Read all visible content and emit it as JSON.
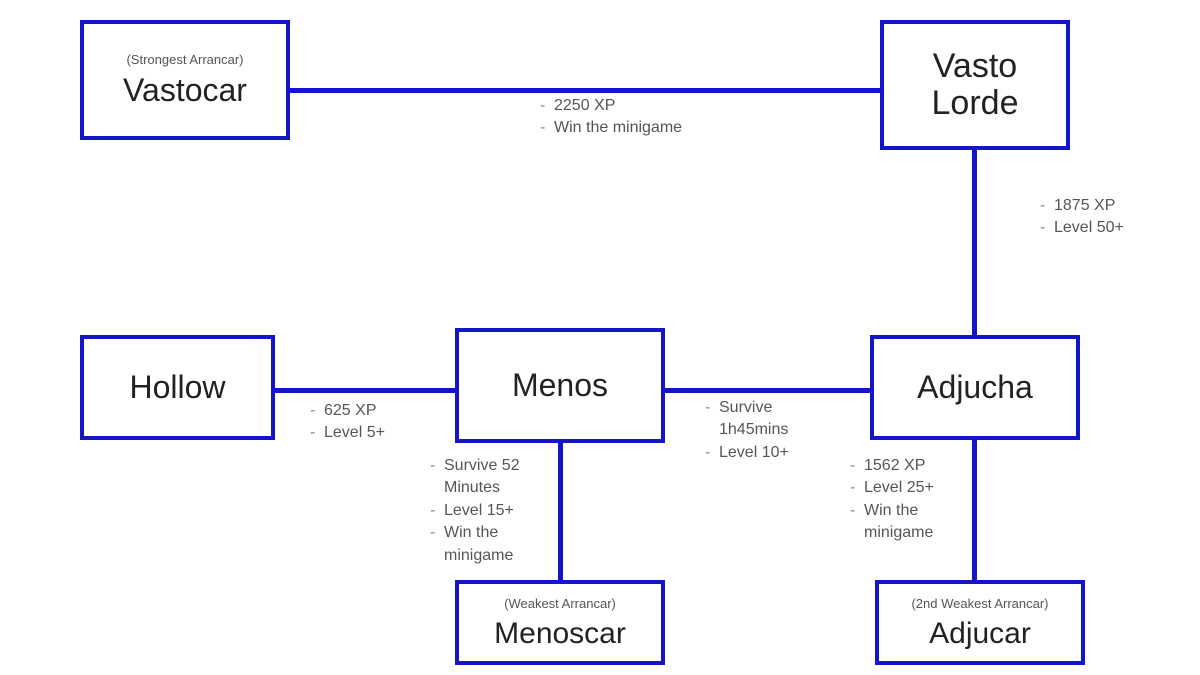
{
  "nodes": {
    "vastocar": {
      "title": "Vastocar",
      "subtitle": "(Strongest Arrancar)"
    },
    "vastolorde": {
      "title": "Vasto Lorde",
      "subtitle": ""
    },
    "hollow": {
      "title": "Hollow",
      "subtitle": ""
    },
    "menos": {
      "title": "Menos",
      "subtitle": ""
    },
    "adjucha": {
      "title": "Adjucha",
      "subtitle": ""
    },
    "menoscar": {
      "title": "Menoscar",
      "subtitle": "(Weakest Arrancar)"
    },
    "adjucar": {
      "title": "Adjucar",
      "subtitle": "(2nd Weakest Arrancar)"
    }
  },
  "edges": {
    "vastocar_vastolorde": {
      "r1": "2250 XP",
      "r2": "Win the minigame"
    },
    "vastolorde_adjucha": {
      "r1": "1875 XP",
      "r2": "Level 50+"
    },
    "hollow_menos": {
      "r1": "625 XP",
      "r2": "Level 5+"
    },
    "menos_adjucha": {
      "r1": "Survive 1h45mins",
      "r2": "Level 10+"
    },
    "menos_menoscar": {
      "r1": "Survive 52 Minutes",
      "r2": "Level 15+",
      "r3": "Win the minigame"
    },
    "adjucha_adjucar": {
      "r1": "1562 XP",
      "r2": "Level 25+",
      "r3": "Win the minigame"
    }
  }
}
